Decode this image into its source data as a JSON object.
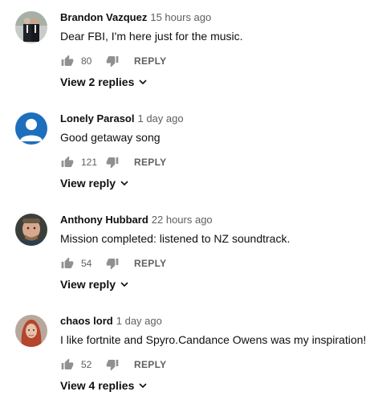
{
  "comments": [
    {
      "author": "Brandon Vazquez",
      "time": "15 hours ago",
      "text": "Dear FBI, I'm here just for the music.",
      "likes": "80",
      "reply_label": "REPLY",
      "view_replies": "View 2 replies",
      "avatar_icon": "avatar-two-men-suits"
    },
    {
      "author": "Lonely Parasol",
      "time": "1 day ago",
      "text": "Good getaway song",
      "likes": "121",
      "reply_label": "REPLY",
      "view_replies": "View reply",
      "avatar_icon": "default-user-avatar"
    },
    {
      "author": "Anthony Hubbard",
      "time": "22 hours ago",
      "text": "Mission completed: listened to NZ soundtrack.",
      "likes": "54",
      "reply_label": "REPLY",
      "view_replies": "View reply",
      "avatar_icon": "avatar-man-face"
    },
    {
      "author": "chaos lord",
      "time": "1 day ago",
      "text": "I like fortnite and Spyro.Candance Owens was my inspiration!",
      "likes": "52",
      "reply_label": "REPLY",
      "view_replies": "View 4 replies",
      "avatar_icon": "avatar-red-hair"
    }
  ],
  "colors": {
    "default_avatar_bg": "#1d6fbd",
    "icon_gray": "#909090",
    "meta_gray": "#606060"
  }
}
